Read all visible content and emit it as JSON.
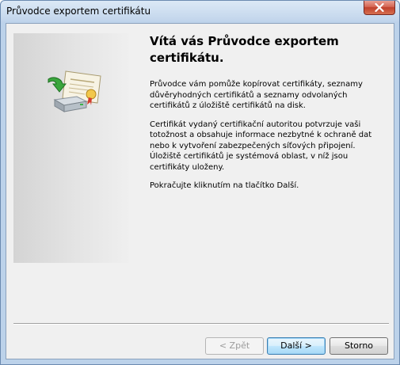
{
  "window": {
    "title": "Průvodce exportem certifikátu"
  },
  "wizard": {
    "heading": "Vítá vás Průvodce exportem certifikátu.",
    "paragraph1": "Průvodce vám pomůže kopírovat certifikáty, seznamy důvěryhodných certifikátů a seznamy odvolaných certifikátů z úložiště certifikátů na disk.",
    "paragraph2": "Certifikát vydaný certifikační autoritou potvrzuje vaši totožnost a obsahuje informace nezbytné k ochraně dat nebo k vytvoření zabezpečených síťových připojení. Úložiště certifikátů je systémová oblast, v níž jsou certifikáty uloženy.",
    "paragraph3": "Pokračujte kliknutím na tlačítko Další.",
    "icon": "certificate-export-icon"
  },
  "buttons": {
    "back_label": "< Zpět",
    "next_label": "Další >",
    "cancel_label": "Storno"
  },
  "colors": {
    "titlebar": "#c6d8ed",
    "client_bg": "#f0f0f0",
    "close_button": "#c0402c",
    "default_button_border": "#3c7fb1"
  }
}
